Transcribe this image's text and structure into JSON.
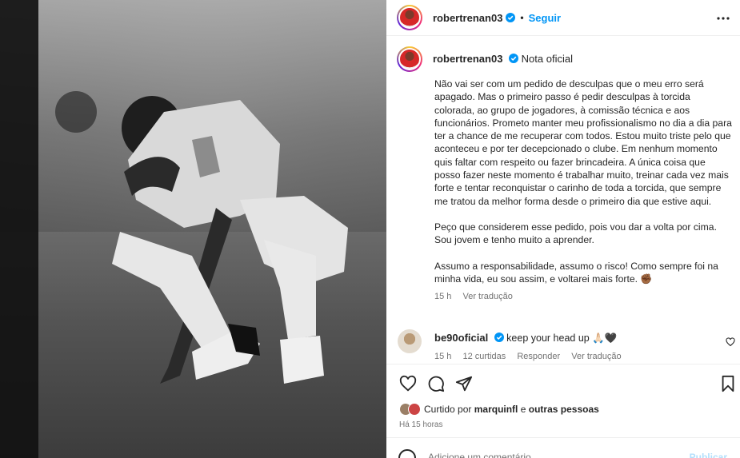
{
  "header": {
    "username": "robertrenan03",
    "separator": "•",
    "follow_label": "Seguir"
  },
  "caption": {
    "username": "robertrenan03",
    "title": "Nota oficial",
    "paragraphs": [
      "Não vai ser com um pedido de desculpas que o meu erro será apagado. Mas o primeiro passo é pedir desculpas à torcida colorada, ao grupo de jogadores, à comissão técnica e aos funcionários. Prometo manter meu profissionalismo no dia a dia para ter a chance de me recuperar com todos. Estou muito triste pelo que aconteceu e por ter decepcionado o clube. Em nenhum momento quis faltar com respeito ou fazer brincadeira. A única coisa que posso fazer neste momento é trabalhar muito, treinar cada vez mais forte e tentar reconquistar o carinho de toda a torcida, que sempre me tratou da melhor forma desde o primeiro dia que estive aqui.",
      "Peço que considerem esse pedido, pois vou dar a volta por cima. Sou jovem e tenho muito a aprender.",
      "Assumo a responsabilidade, assumo o risco! Como sempre foi na minha vida, eu sou assim, e voltarei mais forte. ✊🏾"
    ],
    "time": "15 h",
    "translate": "Ver tradução"
  },
  "comment": {
    "username": "be90oficial",
    "text": "keep your head up 🙏🏻🖤",
    "time": "15 h",
    "likes": "12 curtidas",
    "reply": "Responder",
    "translate": "Ver tradução"
  },
  "likes": {
    "prefix": "Curtido por",
    "user": "marquinfl",
    "connector": "e",
    "others": "outras pessoas"
  },
  "timestamp": "Há 15 horas",
  "add_comment": {
    "placeholder": "Adicione um comentário...",
    "post_label": "Publicar"
  },
  "colors": {
    "accent": "#0095f6",
    "verified": "#0095f6",
    "text": "#262626",
    "muted": "#737373"
  },
  "icons": [
    "verified-icon",
    "more-options-icon",
    "heart-icon",
    "comment-icon",
    "share-icon",
    "save-icon",
    "emoji-icon"
  ]
}
